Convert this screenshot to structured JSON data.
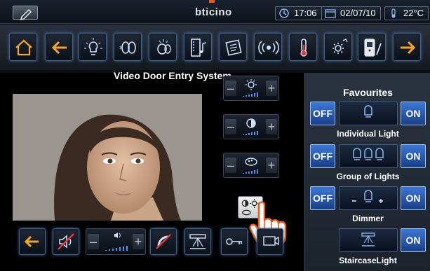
{
  "status": {
    "brand": "bticino",
    "time": "17:06",
    "date": "02/07/10",
    "temperature": "22°C"
  },
  "toolbar": {
    "icons": [
      "home-icon",
      "back-arrow-icon",
      "light-bulb-icon",
      "blinds-icon",
      "scenario-icon",
      "media-icon",
      "memo-icon",
      "radio-icon",
      "thermometer-icon",
      "settings-icon",
      "intercom-icon",
      "forward-arrow-icon"
    ]
  },
  "video": {
    "title": "Video Door Entry System"
  },
  "favourites": {
    "title": "Favourites",
    "rows": [
      {
        "label": "Individual Light",
        "off": "OFF",
        "on": "ON"
      },
      {
        "label": "Group of Lights",
        "off": "OFF",
        "on": "ON"
      },
      {
        "label": "Dimmer",
        "off": "OFF",
        "on": "ON"
      },
      {
        "label": "StaircaseLight",
        "on": "ON"
      }
    ]
  },
  "colors": {
    "accent_blue": "#3b78d6",
    "brand_orange": "#e45a1a",
    "arrow_orange": "#f5a623"
  }
}
